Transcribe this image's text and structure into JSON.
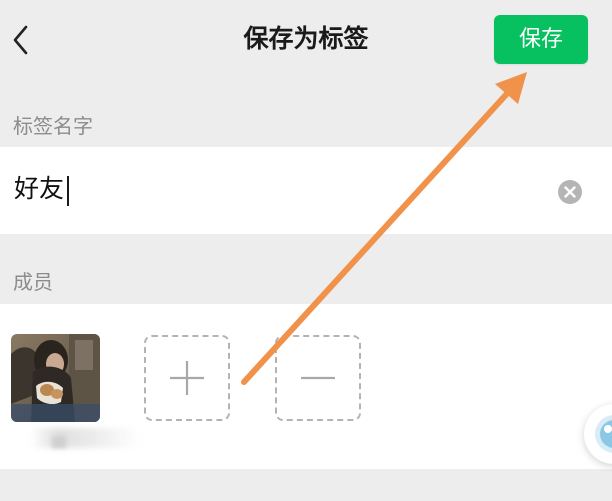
{
  "header": {
    "title": "保存为标签",
    "save_label": "保存",
    "back_icon": "chevron-left-icon"
  },
  "label_section": {
    "title": "标签名字",
    "input_value": "好友",
    "clear_icon": "clear-circle-icon"
  },
  "members_section": {
    "title": "成员",
    "add_icon": "plus-icon",
    "remove_icon": "minus-icon"
  },
  "colors": {
    "accent": "#07c160",
    "background": "#ededed",
    "annotation_arrow": "#f0924a"
  }
}
